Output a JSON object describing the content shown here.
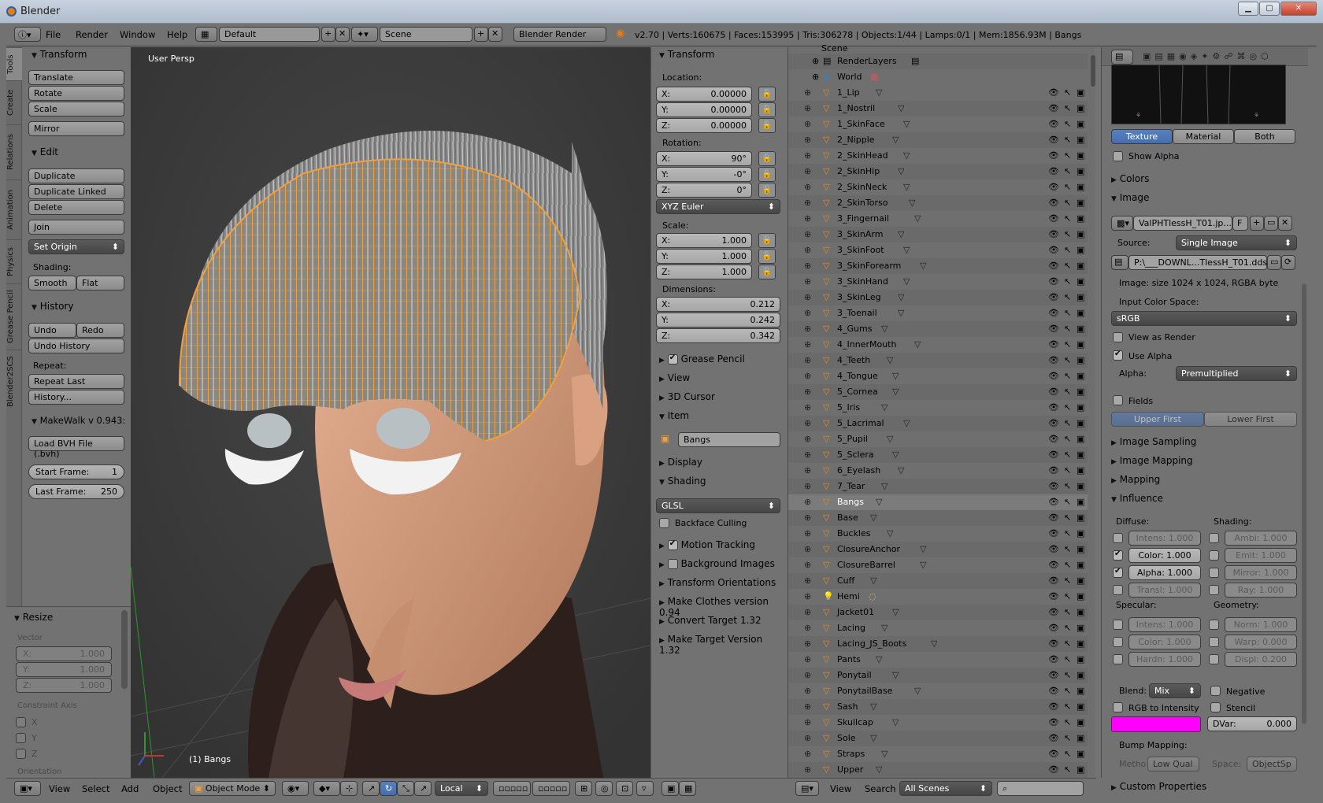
{
  "window": {
    "title": "Blender"
  },
  "info": {
    "menus": [
      "File",
      "Render",
      "Window",
      "Help"
    ],
    "screen_layout": "Default",
    "scene": "Scene",
    "engine": "Blender Render",
    "stats": "v2.70 | Verts:160675 | Faces:153995 | Tris:306278 | Objects:1/44 | Lamps:0/1 | Mem:1856.93M | Bangs"
  },
  "lefttabs": [
    "Tools",
    "Create",
    "Relations",
    "Animation",
    "Physics",
    "Grease Pencil",
    "Blender2SCS"
  ],
  "tools": {
    "transform": {
      "title": "Transform",
      "buttons": [
        "Translate",
        "Rotate",
        "Scale",
        "Mirror"
      ]
    },
    "edit": {
      "title": "Edit",
      "buttons": [
        "Duplicate",
        "Duplicate Linked",
        "Delete",
        "Join"
      ],
      "set_origin": "Set Origin",
      "shading_label": "Shading:",
      "smooth": "Smooth",
      "flat": "Flat"
    },
    "history": {
      "title": "History",
      "undo": "Undo",
      "redo": "Redo",
      "undo_history": "Undo History",
      "repeat_label": "Repeat:",
      "repeat_last": "Repeat Last",
      "history_btn": "History..."
    },
    "makewalk": {
      "title": "MakeWalk v 0.943:",
      "load_bvh": "Load BVH File (.bvh)",
      "start_frame_label": "Start Frame:",
      "start_frame": "1",
      "last_frame_label": "Last Frame:",
      "last_frame": "250"
    }
  },
  "redo": {
    "title": "Resize",
    "vector_label": "Vector",
    "x": "X:",
    "xv": "1.000",
    "y": "Y:",
    "yv": "1.000",
    "z": "Z:",
    "zv": "1.000",
    "constraint_label": "Constraint Axis",
    "cx": "X",
    "cy": "Y",
    "cz": "Z",
    "orientation": "Orientation"
  },
  "viewport": {
    "label": "User Persp",
    "object_label": "(1) Bangs"
  },
  "npanel": {
    "transform_title": "Transform",
    "location_label": "Location:",
    "loc": [
      "X:",
      "0.00000",
      "Y:",
      "0.00000",
      "Z:",
      "0.00000"
    ],
    "rotation_label": "Rotation:",
    "rot": [
      "X:",
      "90°",
      "Y:",
      "-0°",
      "Z:",
      "0°"
    ],
    "rot_mode": "XYZ Euler",
    "scale_label": "Scale:",
    "scale": [
      "X:",
      "1.000",
      "Y:",
      "1.000",
      "Z:",
      "1.000"
    ],
    "dims_label": "Dimensions:",
    "dims": [
      "X:",
      "0.212",
      "Y:",
      "0.242",
      "Z:",
      "0.342"
    ],
    "grease_pencil": "Grease Pencil",
    "view": "View",
    "cursor": "3D Cursor",
    "item": "Item",
    "item_name": "Bangs",
    "display": "Display",
    "shading": "Shading",
    "shading_mode": "GLSL",
    "backface": "Backface Culling",
    "motion": "Motion Tracking",
    "bg_images": "Background Images",
    "transform_orient": "Transform Orientations",
    "make_clothes": "Make Clothes version 0.94",
    "convert_target": "Convert Target 1.32",
    "make_target": "Make Target  Version 1.32"
  },
  "outliner": {
    "top": [
      "Scene",
      "RenderLayers",
      "World"
    ],
    "items": [
      "1_Lip",
      "1_Nostril",
      "1_SkinFace",
      "2_Nipple",
      "2_SkinHead",
      "2_SkinHip",
      "2_SkinNeck",
      "2_SkinTorso",
      "3_Fingernail",
      "3_SkinArm",
      "3_SkinFoot",
      "3_SkinForearm",
      "3_SkinHand",
      "3_SkinLeg",
      "3_Toenail",
      "4_Gums",
      "4_InnerMouth",
      "4_Teeth",
      "4_Tongue",
      "5_Cornea",
      "5_Iris",
      "5_Lacrimal",
      "5_Pupil",
      "5_Sclera",
      "6_Eyelash",
      "7_Tear",
      "Bangs",
      "Base",
      "Buckles",
      "ClosureAnchor",
      "ClosureBarrel",
      "Cuff",
      "Hemi",
      "Jacket01",
      "Lacing",
      "Lacing_JS_Boots",
      "Pants",
      "Ponytail",
      "PonytailBase",
      "Sash",
      "Skullcap",
      "Sole",
      "Straps",
      "Upper"
    ],
    "bottom_menus": [
      "View",
      "Search"
    ],
    "scenes": "All Scenes"
  },
  "props": {
    "tabs": [
      "Texture",
      "Material",
      "Both"
    ],
    "show_alpha": "Show Alpha",
    "colors": "Colors",
    "image": "Image",
    "image_name": "ValPHTlessH_T01.jp...",
    "image_f": "F",
    "source_label": "Source:",
    "source": "Single Image",
    "path": "P:\\___DOWNL...TlessH_T01.dds",
    "image_info": "Image: size 1024 x 1024, RGBA byte",
    "input_cs_label": "Input Color Space:",
    "input_cs": "sRGB",
    "view_as_render": "View as Render",
    "use_alpha": "Use Alpha",
    "alpha_label": "Alpha:",
    "alpha": "Premultiplied",
    "fields": "Fields",
    "upper_first": "Upper First",
    "lower_first": "Lower First",
    "image_sampling": "Image Sampling",
    "image_mapping": "Image Mapping",
    "mapping": "Mapping",
    "influence": "Influence",
    "diffuse_label": "Diffuse:",
    "shading_label": "Shading:",
    "intens": "Intens: 1.000",
    "color": "Color:  1.000",
    "alpha_inf": "Alpha: 1.000",
    "transl": "Transl: 1.000",
    "ambi": "Ambi: 1.000",
    "emit": "Emit:  1.000",
    "mirror": "Mirror: 1.000",
    "ray": "Ray: 1.000",
    "specular_label": "Specular:",
    "geometry_label": "Geometry:",
    "sintens": "Intens: 1.000",
    "scolor": "Color: 1.000",
    "hardn": "Hardn: 1.000",
    "norm": "Norm: 1.000",
    "warp": "Warp: 0.000",
    "displ": "Displ: 0.200",
    "blend_label": "Blend:",
    "blend": "Mix",
    "negative": "Negative",
    "rgb_to_intensity": "RGB to Intensity",
    "stencil": "Stencil",
    "dvar_label": "DVar:",
    "dvar": "0.000",
    "magenta": "#ff00ff",
    "bump_label": "Bump Mapping:",
    "method_label": "Metho",
    "method": "Low Qual",
    "space_label": "Space:",
    "space": "ObjectSp",
    "custom_props": "Custom Properties"
  },
  "bottombar": {
    "view": "View",
    "select": "Select",
    "add": "Add",
    "object": "Object",
    "mode": "Object Mode",
    "pivot": "Local"
  }
}
